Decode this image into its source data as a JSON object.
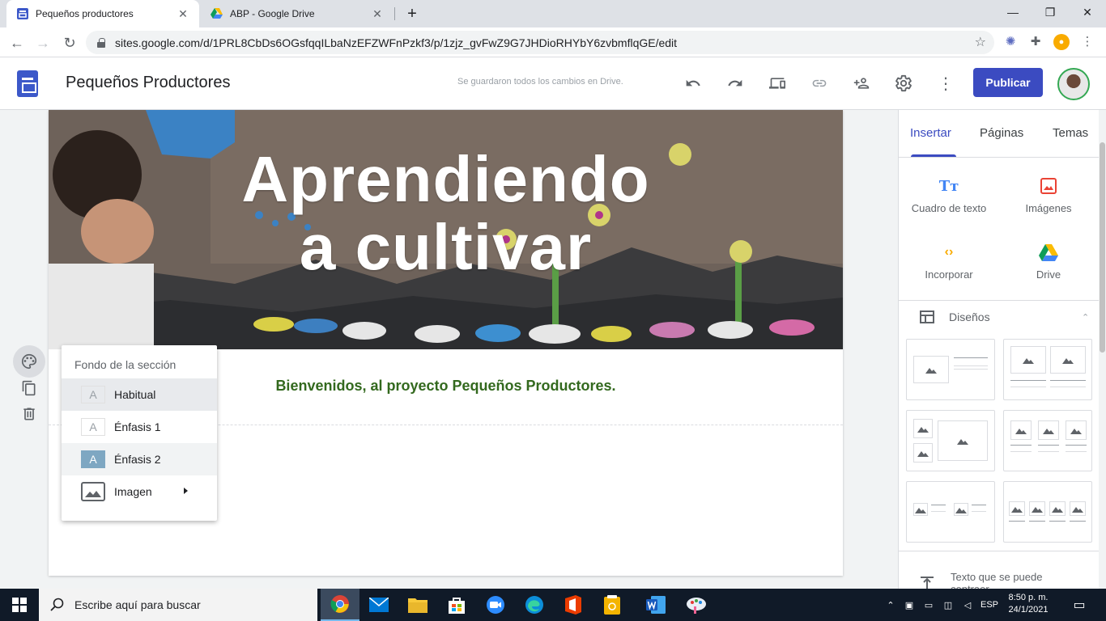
{
  "browser": {
    "tabs": [
      {
        "title": "Pequeños productores",
        "active": true
      },
      {
        "title": "ABP - Google Drive",
        "active": false
      }
    ],
    "url": "sites.google.com/d/1PRL8CbDs6OGsfqqILbaNzEFZWFnPzkf3/p/1zjz_gvFwZ9G7JHDioRHYbY6zvbmflqGE/edit"
  },
  "header": {
    "site_name": "Pequeños Productores",
    "save_status": "Se guardaron todos los cambios en Drive.",
    "publish_label": "Publicar"
  },
  "page": {
    "hero_title_line1": "Aprendiendo",
    "hero_title_line2": "a cultivar",
    "welcome_text": "Bienvenidos, al proyecto Pequeños Productores."
  },
  "section_menu": {
    "title": "Fondo de la sección",
    "items": [
      {
        "swatch": "A",
        "label": "Habitual"
      },
      {
        "swatch": "A",
        "label": "Énfasis 1"
      },
      {
        "swatch": "A",
        "label": "Énfasis 2"
      },
      {
        "label": "Imagen"
      }
    ]
  },
  "panel": {
    "tabs": [
      "Insertar",
      "Páginas",
      "Temas"
    ],
    "insert_items": [
      {
        "label": "Cuadro de texto",
        "icon": "text-box-icon"
      },
      {
        "label": "Imágenes",
        "icon": "image-icon"
      },
      {
        "label": "Incorporar",
        "icon": "embed-code-icon"
      },
      {
        "label": "Drive",
        "icon": "google-drive-icon"
      }
    ],
    "layouts_label": "Diseños",
    "textbox_item": "Texto que se puede contraer"
  },
  "taskbar": {
    "search_placeholder": "Escribe aquí para buscar",
    "language": "ESP",
    "time": "8:50 p. m.",
    "date": "24/1/2021"
  },
  "colors": {
    "accent": "#3b4bc1",
    "welcome_text": "#33691e",
    "emphasis2": "#7ea7c2"
  }
}
